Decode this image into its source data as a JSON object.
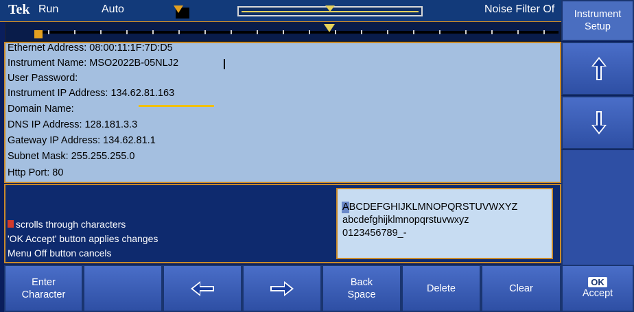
{
  "topbar": {
    "brand": "Tek",
    "run_status": "Run",
    "trigger_mode": "Auto",
    "noise_filter": "Noise Filter Of"
  },
  "settings": {
    "rows": [
      "Ethernet Address: 08:00:11:1F:7D:D5",
      "Instrument Name:   MSO2022B-05NLJ2",
      "User Password:",
      "Instrument IP Address:   134.62.81.163",
      "Domain Name:",
      "DNS IP Address:   128.181.3.3",
      "Gateway IP Address:   134.62.81.1",
      "Subnet Mask:   255.255.255.0",
      "Http Port:  80"
    ]
  },
  "help": {
    "lines": [
      "scrolls through characters",
      "'OK Accept' button applies changes",
      "Menu Off button cancels"
    ]
  },
  "charset": {
    "lines": [
      "ABCDEFGHIJKLMNOPQRSTUVWXYZ",
      "abcdefghijklmnopqrstuvwxyz",
      "0123456789_-"
    ]
  },
  "side_menu": {
    "title": "Instrument Setup",
    "up_icon": "arrow-up-icon",
    "down_icon": "arrow-down-icon",
    "accept_key": "OK",
    "accept_label": "Accept"
  },
  "bottom_menu": {
    "enter_character": "Enter Character",
    "left_icon": "arrow-left-icon",
    "right_icon": "arrow-right-icon",
    "back_space": "Back Space",
    "delete": "Delete",
    "clear": "Clear"
  },
  "colors": {
    "panel_bg": "#a4bfe0",
    "border": "#c98a2a",
    "button_blue": "#2e4fa4",
    "accent_yellow": "#f0c000"
  }
}
